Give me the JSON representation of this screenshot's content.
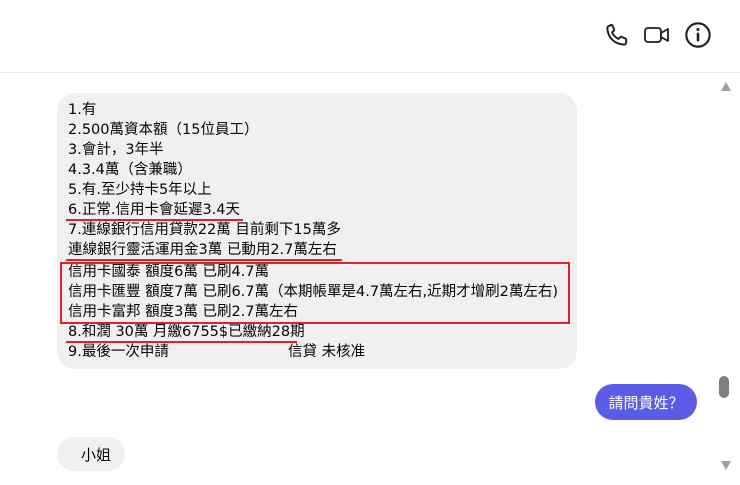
{
  "header": {
    "phone_icon": "phone-icon",
    "video_icon": "video-camera-icon",
    "info_icon": "info-icon"
  },
  "messages": {
    "received_1": {
      "lines": [
        "1.有",
        "2.500萬資本額（15位員工）",
        "3.會計，3年半",
        "4.3.4萬（含兼職）",
        "5.有.至少持卡5年以上",
        "6.正常.信用卡會延遲3.4天",
        "7.連線銀行信用貸款22萬 目前剩下15萬多",
        "連線銀行靈活運用金3萬 已動用2.7萬左右",
        "信用卡國泰 額度6萬 已刷4.7萬",
        "信用卡匯豐 額度7萬 已刷6.7萬（本期帳單是4.7萬左右,近期才增刷2萬左右)",
        "信用卡富邦 額度3萬 已刷2.7萬左右",
        "8.和潤 30萬 月繳6755$已繳納28期",
        "9.最後一次申請",
        "信貸 未核准"
      ]
    },
    "sent_1": {
      "text": "請問貴姓？"
    },
    "received_2": {
      "text": "小姐"
    }
  },
  "colors": {
    "sent_bubble": "#5b5ce6",
    "received_bubble": "#f0f0f0",
    "annotation_red": "#e2202a"
  }
}
